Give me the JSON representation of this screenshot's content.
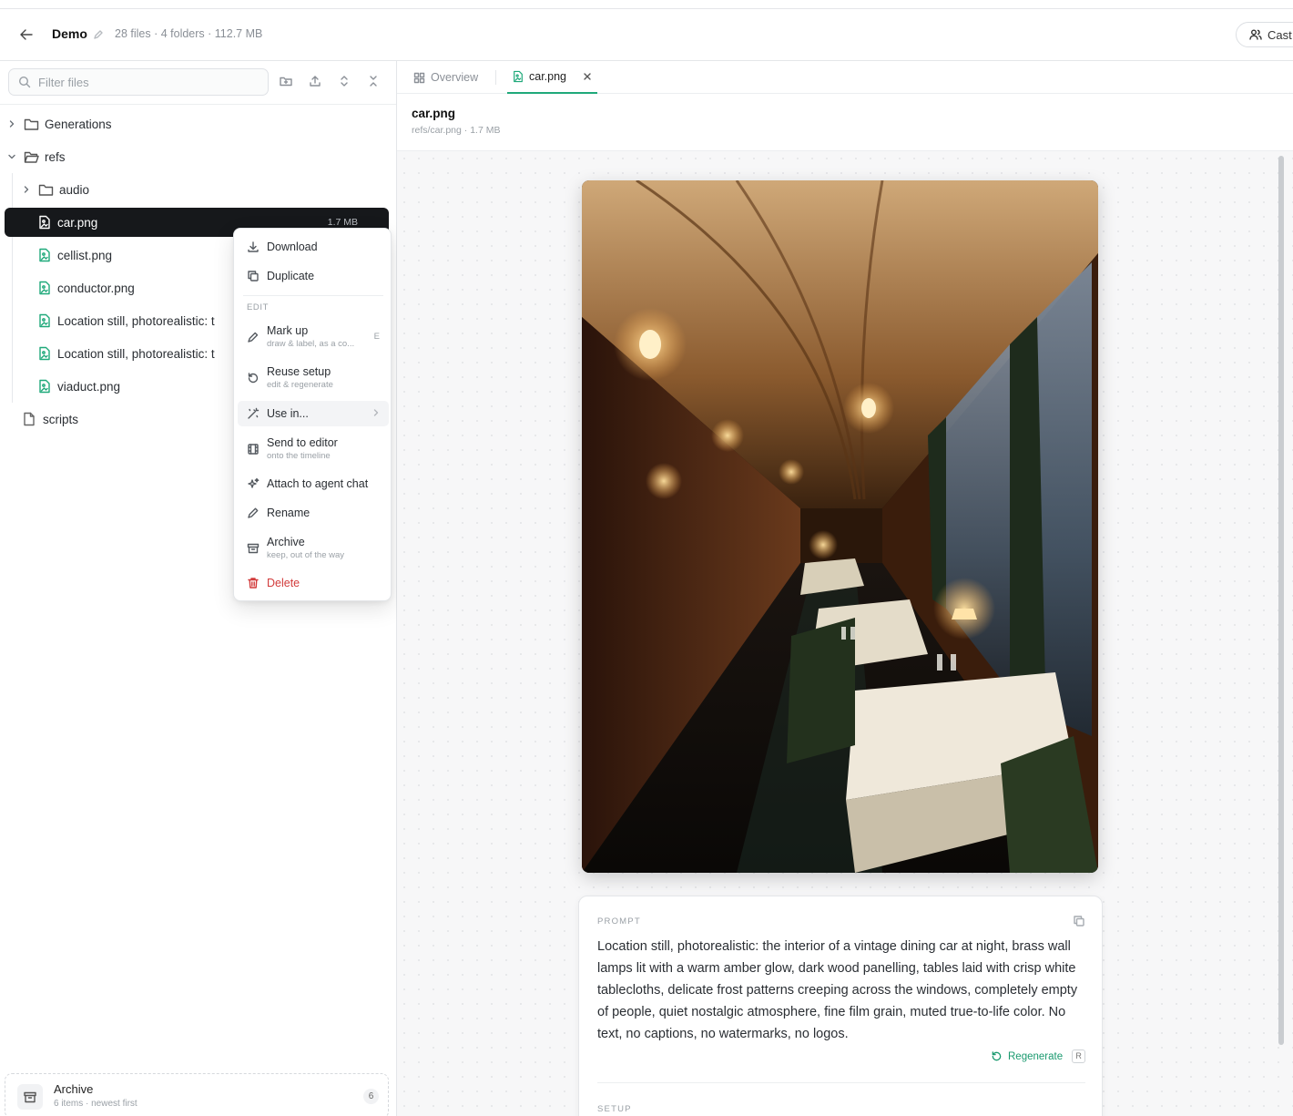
{
  "header": {
    "project_name": "Demo",
    "meta": "28 files · 4 folders · 112.7 MB",
    "cast_label": "Cast"
  },
  "sidebar": {
    "filter_placeholder": "Filter files",
    "tree": [
      {
        "label": "Generations",
        "type": "folder",
        "expanded": false
      },
      {
        "label": "refs",
        "type": "folder",
        "expanded": true
      },
      {
        "label": "audio",
        "type": "folder",
        "expanded": false
      },
      {
        "label": "car.png",
        "type": "image",
        "size": "1.7 MB",
        "selected": true
      },
      {
        "label": "cellist.png",
        "type": "image"
      },
      {
        "label": "conductor.png",
        "type": "image"
      },
      {
        "label": "Location still, photorealistic: t",
        "type": "image"
      },
      {
        "label": "Location still, photorealistic: t",
        "type": "image"
      },
      {
        "label": "viaduct.png",
        "type": "image"
      },
      {
        "label": "scripts",
        "type": "file"
      }
    ],
    "archive": {
      "title": "Archive",
      "subtitle": "6 items · newest first",
      "count": "6"
    }
  },
  "context_menu": {
    "section_label": "EDIT",
    "items": [
      {
        "label": "Download",
        "icon": "download-icon"
      },
      {
        "label": "Duplicate",
        "icon": "duplicate-icon"
      },
      {
        "label": "Mark up",
        "sub": "draw & label, as a co...",
        "shortcut": "E",
        "icon": "pen-icon"
      },
      {
        "label": "Reuse setup",
        "sub": "edit & regenerate",
        "icon": "rotate-icon"
      },
      {
        "label": "Use in...",
        "icon": "magic-wand-icon"
      },
      {
        "label": "Send to editor",
        "sub": "onto the timeline",
        "icon": "film-icon"
      },
      {
        "label": "Attach to agent chat",
        "icon": "sparkles-icon"
      },
      {
        "label": "Rename",
        "icon": "pencil-icon"
      },
      {
        "label": "Archive",
        "sub": "keep, out of the way",
        "icon": "archive-icon"
      },
      {
        "label": "Delete",
        "icon": "trash-icon",
        "color": "#d23b3b"
      }
    ]
  },
  "tabs": [
    {
      "label": "Overview",
      "active": false
    },
    {
      "label": "car.png",
      "active": true
    }
  ],
  "viewer": {
    "title": "car.png",
    "meta": "refs/car.png · 1.7 MB"
  },
  "prompt": {
    "label": "PROMPT",
    "text": "Location still, photorealistic: the interior of a vintage dining car at night, brass wall lamps lit with a warm amber glow, dark wood panelling, tables laid with crisp white tablecloths, delicate frost patterns creeping across the windows, completely empty of people, quiet nostalgic atmosphere, fine film grain, muted true-to-life color. No text, no captions, no watermarks, no logos.",
    "regenerate_label": "Regenerate",
    "regenerate_key": "R",
    "setup_label": "SETUP"
  },
  "colors": {
    "accent": "#1fa97a",
    "danger": "#d23b3b",
    "selected_row": "#16181b"
  }
}
